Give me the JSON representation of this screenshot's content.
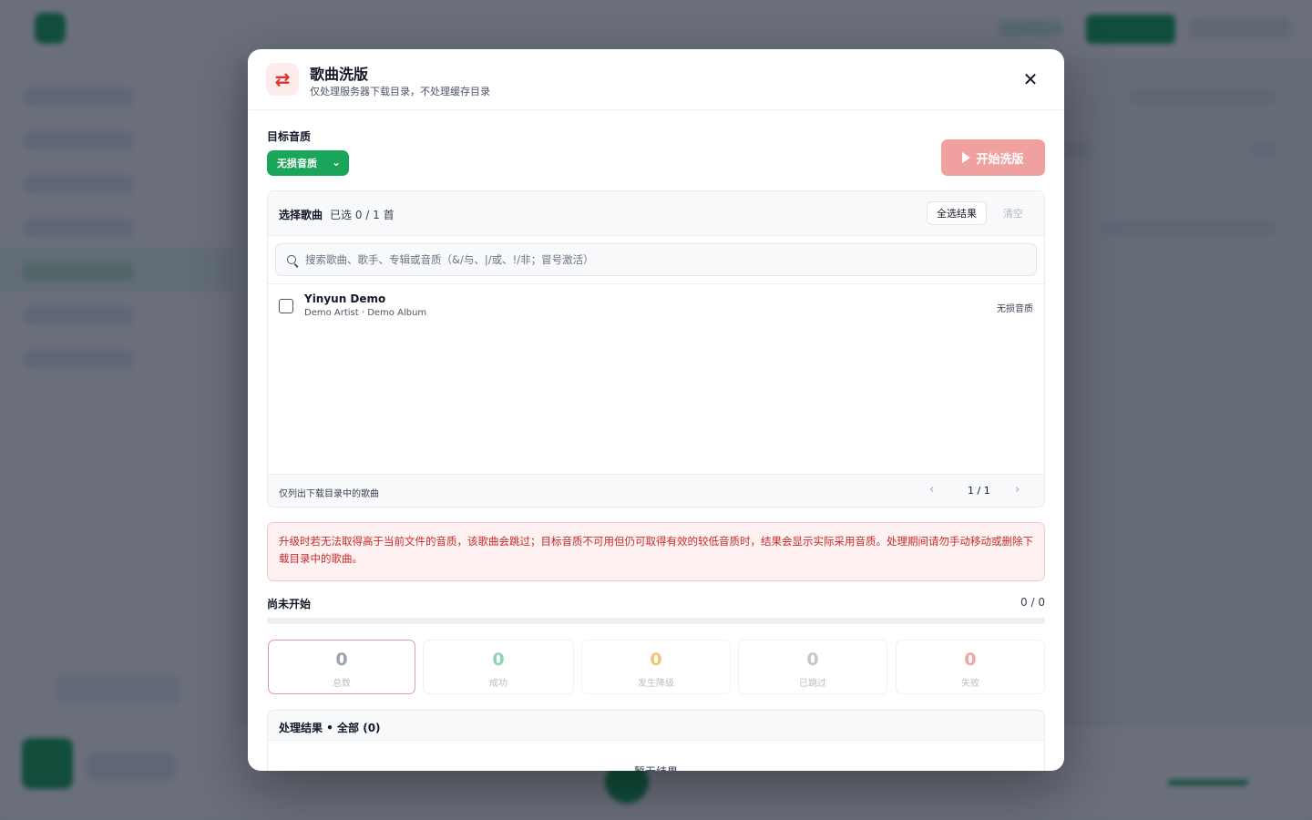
{
  "modal": {
    "title": "歌曲洗版",
    "subtitle": "仅处理服务器下载目录，不处理缓存目录",
    "header_icon": "swap-arrows-icon",
    "close_icon": "close-icon"
  },
  "quality": {
    "label": "目标音质",
    "selected": "无损音质"
  },
  "start_button": {
    "label": "开始洗版"
  },
  "song_panel": {
    "title": "选择歌曲",
    "count_text": "已选 0 / 1 首",
    "select_all_label": "全选结果",
    "clear_label": "清空",
    "search_placeholder": "搜索歌曲、歌手、专辑或音质（&/与、|/或、!/非；冒号激活）",
    "songs": [
      {
        "title": "Yinyun Demo",
        "meta": "Demo Artist · Demo Album",
        "quality": "无损音质",
        "checked": false
      }
    ],
    "footer_note": "仅列出下载目录中的歌曲",
    "pager": "1 / 1"
  },
  "warning": {
    "text": "升级时若无法取得高于当前文件的音质，该歌曲会跳过；目标音质不可用但仍可取得有效的较低音质时，结果会显示实际采用音质。处理期间请勿手动移动或删除下载目录中的歌曲。"
  },
  "progress": {
    "status": "尚未开始",
    "count": "0 / 0",
    "fraction": 0
  },
  "stats": [
    {
      "value": "0",
      "label": "总数",
      "color": "#9ca3af"
    },
    {
      "value": "0",
      "label": "成功",
      "color": "#8fd3b0"
    },
    {
      "value": "0",
      "label": "发生降级",
      "color": "#f5c27a"
    },
    {
      "value": "0",
      "label": "已跳过",
      "color": "#c3c8ce"
    },
    {
      "value": "0",
      "label": "失败",
      "color": "#f4a3a3"
    }
  ],
  "results": {
    "title": "处理结果 • 全部 (0)",
    "empty": "暂无结果"
  },
  "colors": {
    "brand": "#1aa65a",
    "danger": "#e03131"
  }
}
